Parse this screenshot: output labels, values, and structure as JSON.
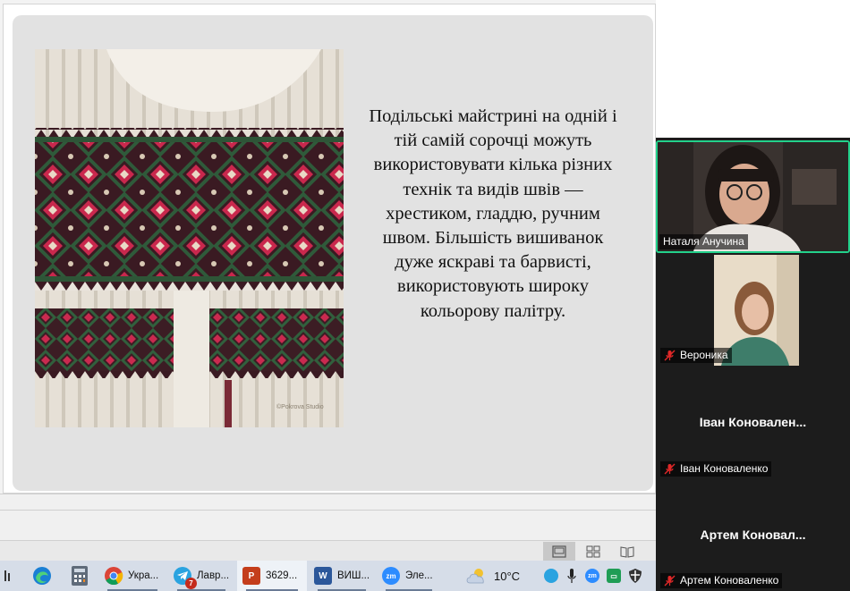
{
  "slide": {
    "text": "Подільські майстрині на одній і тій самій сорочці можуть використовувати кілька різних технік та видів швів — хрестиком, гладдю, ручним швом. Більшість вишиванок дуже яскраві та барвисті, використовують широку кольорову палітру.",
    "photo_watermark": "©Pokrova Studio"
  },
  "participants": [
    {
      "name": "Наталя Анучина",
      "muted": false,
      "video": true,
      "speaking": true
    },
    {
      "name": "Вероника",
      "muted": true,
      "video": true
    },
    {
      "name": "Іван Коноваленко",
      "display": "Іван  Коновален...",
      "muted": true,
      "video": false
    },
    {
      "name": "Артем Коноваленко",
      "display": "Артем  Коновал...",
      "muted": true,
      "video": false
    }
  ],
  "taskbar": {
    "items": [
      {
        "label": "Укра...",
        "icon": "chrome-icon"
      },
      {
        "label": "Лавр...",
        "icon": "telegram-icon",
        "badge": "7"
      },
      {
        "label": "3629...",
        "icon": "powerpoint-icon"
      },
      {
        "label": "ВИШ...",
        "icon": "word-icon"
      },
      {
        "label": "Эле...",
        "icon": "zoom-icon"
      }
    ],
    "weather": "10°C"
  },
  "colors": {
    "zoom_speaking_border": "#23d18b",
    "mute_red": "#e02828",
    "taskbar": "#d6dde8"
  }
}
